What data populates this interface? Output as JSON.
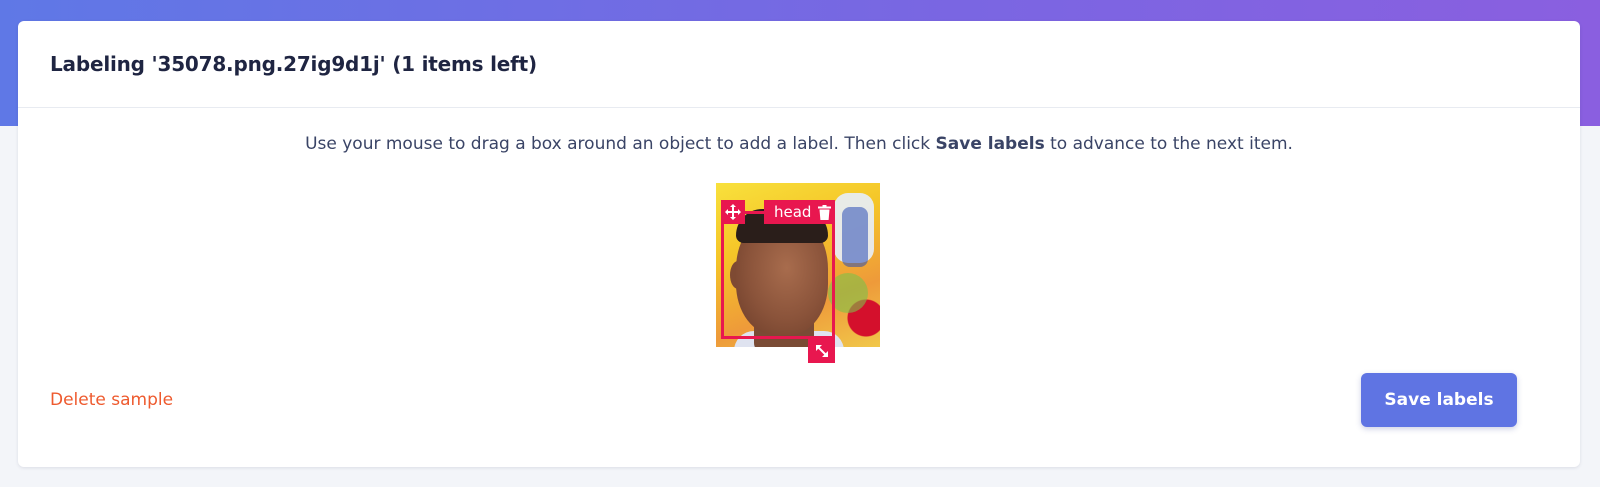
{
  "header": {
    "title": "Labeling '35078.png.27ig9d1j' (1 items left)"
  },
  "instructions": {
    "prefix": "Use your mouse to drag a box around an object to add a label. Then click ",
    "emphasis": "Save labels",
    "suffix": " to advance to the next item."
  },
  "annotation": {
    "label": "head",
    "color": "#e8174f",
    "move_icon": "move-icon",
    "delete_icon": "trash-icon",
    "resize_icon": "resize-icon"
  },
  "actions": {
    "delete_label": "Delete sample",
    "save_label": "Save labels",
    "save_color": "#5f74e3",
    "delete_color": "#ee5a2e"
  }
}
